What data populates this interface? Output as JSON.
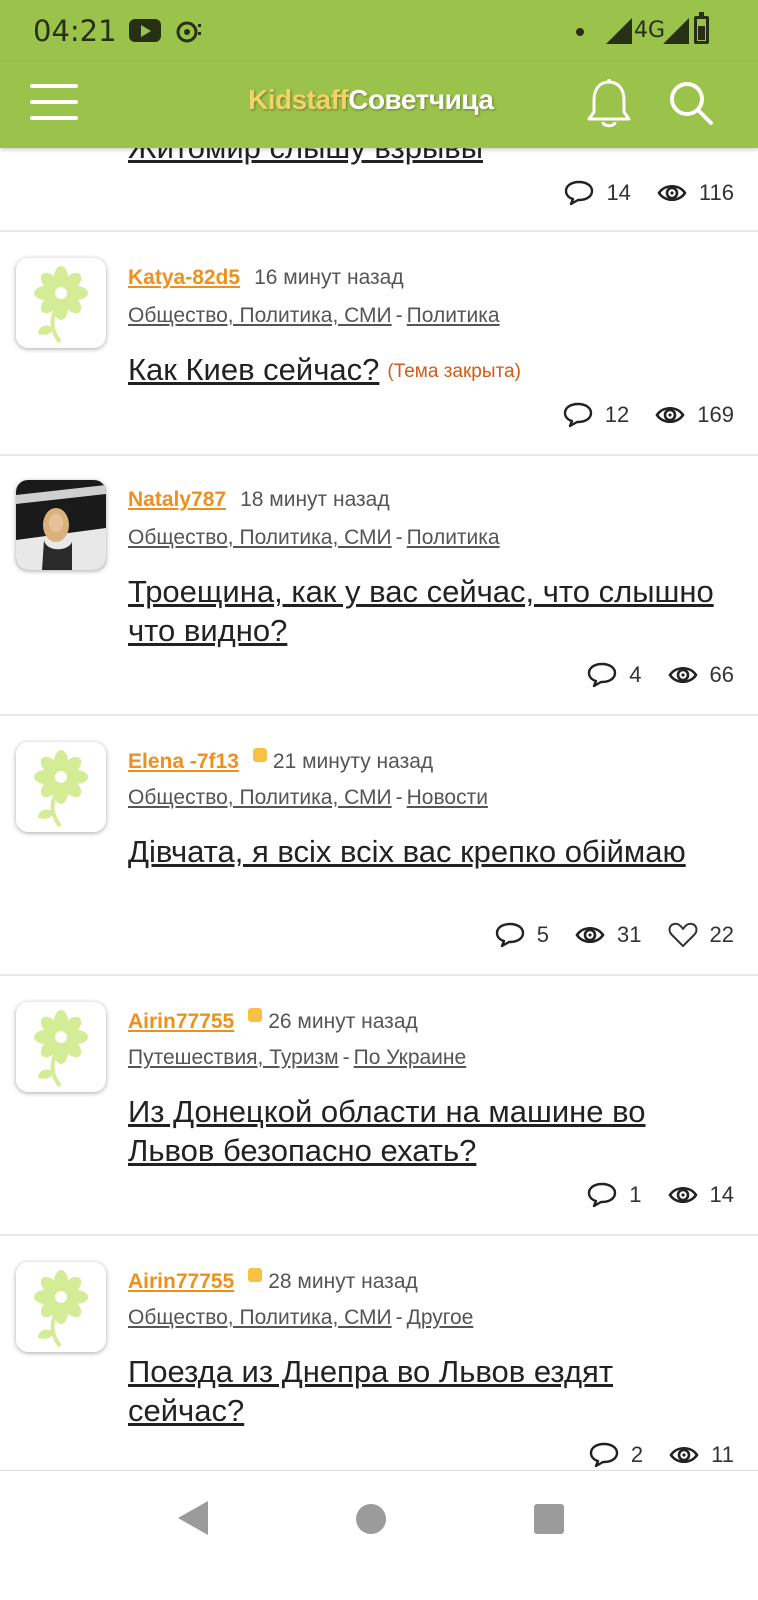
{
  "status_bar": {
    "time": "04:21",
    "network": "4G"
  },
  "header": {
    "logo_part1": "Kidstaff",
    "logo_part2": "Советчица",
    "icons": [
      "menu-icon",
      "bell-icon",
      "search-icon"
    ]
  },
  "colors": {
    "header_bg": "#9bc24a",
    "author": "#f0901c",
    "closed_tag": "#d45a14",
    "badge": "#f8c143",
    "logo_accent": "#f3d268"
  },
  "posts": [
    {
      "title": "Житомир слышу взрывы",
      "comments": "14",
      "views": "116"
    },
    {
      "author": "Katya-82d5",
      "time": "16 минут назад",
      "section": "Общество, Политика, СМИ",
      "subsection": "Политика",
      "title": "Как Киев сейчас?",
      "closed_label": "(Тема закрыта)",
      "comments": "12",
      "views": "169"
    },
    {
      "author": "Nataly787",
      "time": "18 минут назад",
      "section": "Общество, Политика, СМИ",
      "subsection": "Политика",
      "title": "Троещина, как у вас сейчас, что слышно что видно?",
      "comments": "4",
      "views": "66"
    },
    {
      "author": "Elena -7f13",
      "time": "21 минуту назад",
      "section": "Общество, Политика, СМИ",
      "subsection": "Новости",
      "title": "Дівчата, я всіх всіх вас крепко обіймаю",
      "comments": "5",
      "views": "31",
      "likes": "22"
    },
    {
      "author": "Airin77755",
      "time": "26 минут назад",
      "section": "Путешествия, Туризм",
      "subsection": "По Украине",
      "title": "Из Донецкой области на машине во Львов безопасно ехать?",
      "comments": "1",
      "views": "14"
    },
    {
      "author": "Airin77755",
      "time": "28 минут назад",
      "section": "Общество, Политика, СМИ",
      "subsection": "Другое",
      "title": "Поезда из Днепра во Львов ездят сейчас?",
      "comments": "2",
      "views": "11"
    }
  ],
  "separator": "-"
}
